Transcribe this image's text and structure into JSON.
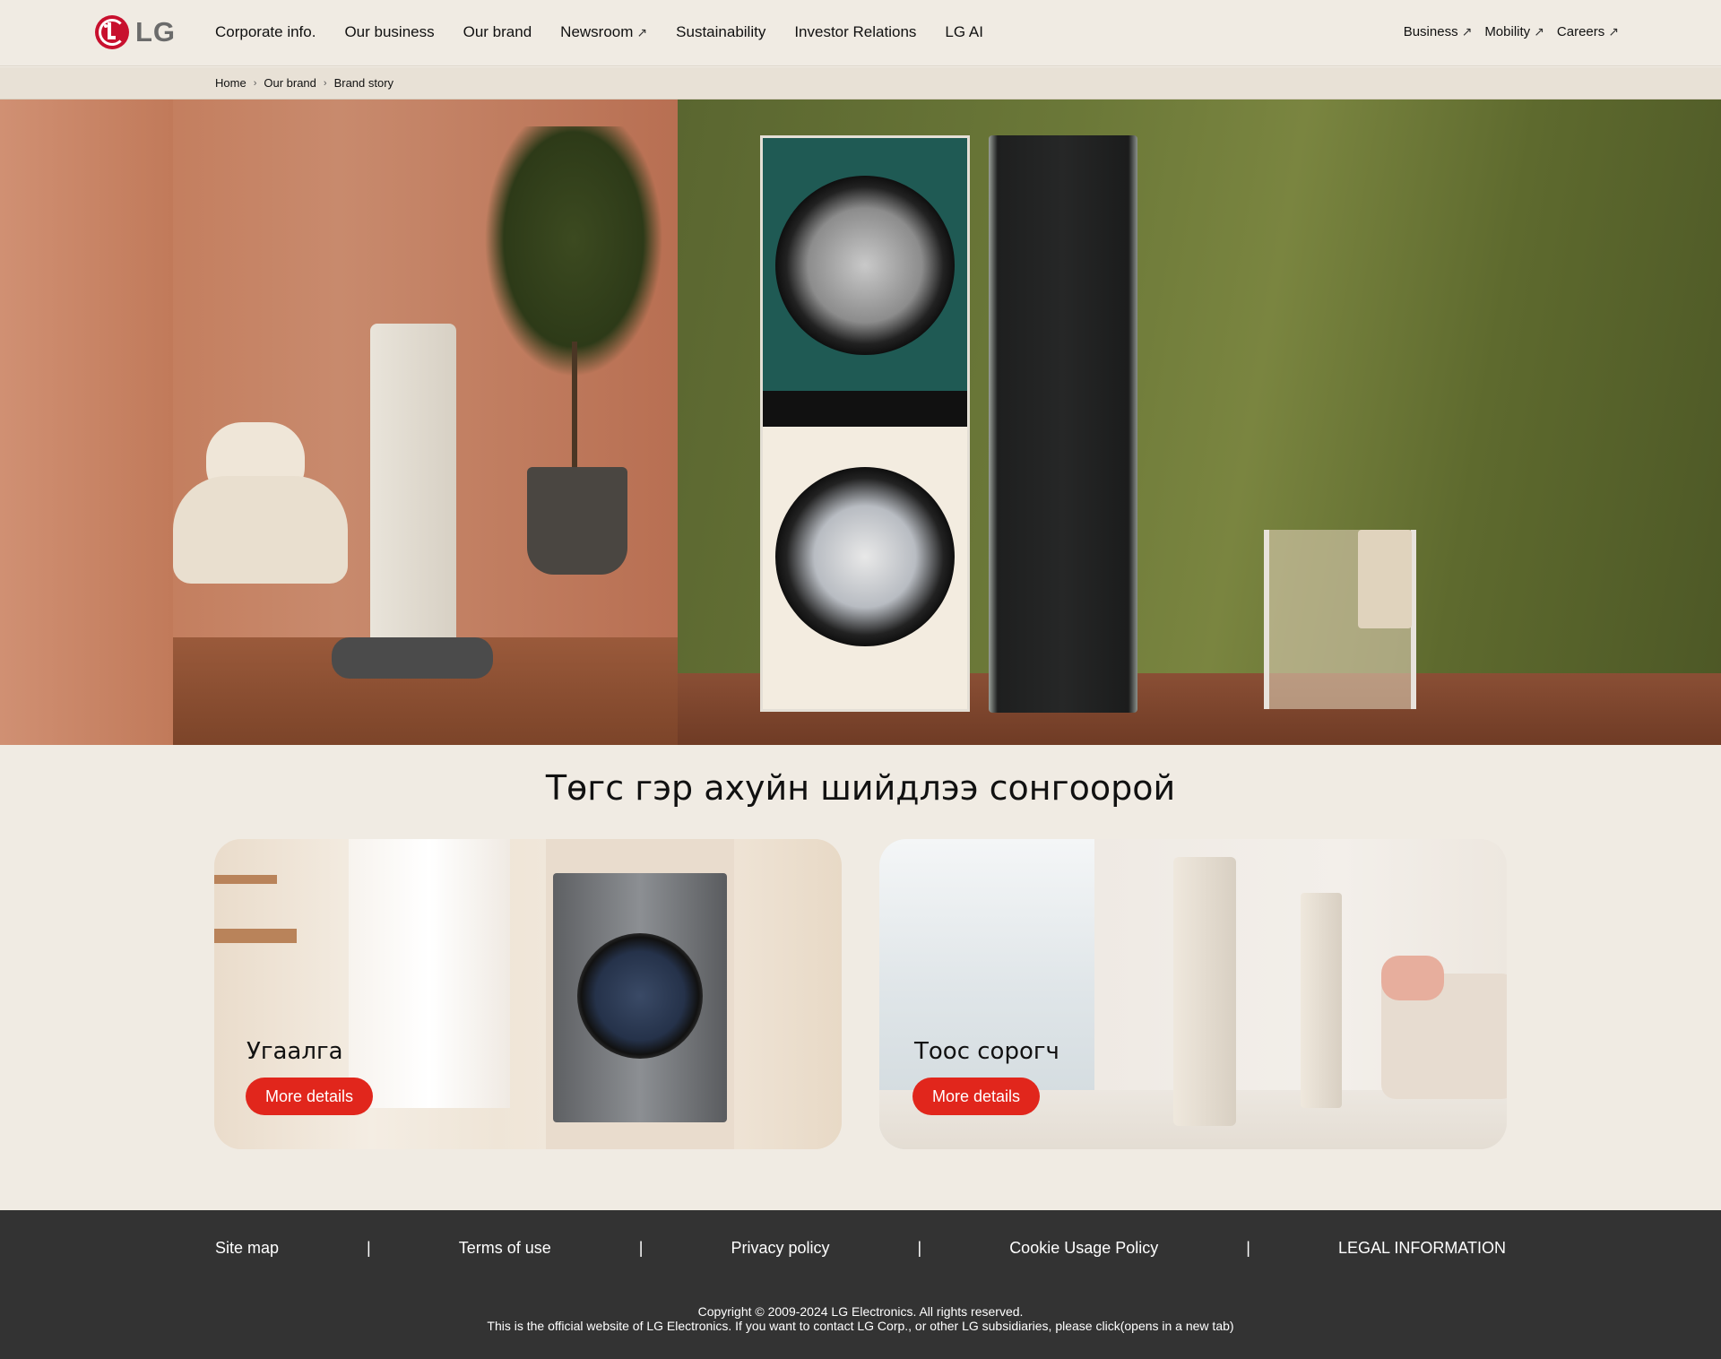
{
  "header": {
    "logo_text": "LG",
    "nav": [
      {
        "label": "Corporate info.",
        "external": false
      },
      {
        "label": "Our business",
        "external": false
      },
      {
        "label": "Our brand",
        "external": false
      },
      {
        "label": "Newsroom",
        "external": true
      },
      {
        "label": "Sustainability",
        "external": false
      },
      {
        "label": "Investor Relations",
        "external": false
      },
      {
        "label": "LG AI",
        "external": false
      }
    ],
    "right_nav": [
      {
        "label": "Business",
        "external": true
      },
      {
        "label": "Mobility",
        "external": true
      },
      {
        "label": "Careers",
        "external": true
      }
    ],
    "external_glyph": "↗"
  },
  "breadcrumb": {
    "items": [
      "Home",
      "Our brand",
      "Brand story"
    ],
    "separator": "›"
  },
  "hero": {
    "accent_left": "#c37c5c",
    "accent_right": "#6b7838"
  },
  "section": {
    "title": "Төгс гэр ахуйн шийдлээ сонгоорой"
  },
  "cards": [
    {
      "label": "Угаалга",
      "button": "More details"
    },
    {
      "label": "Тоос сорогч",
      "button": "More details"
    }
  ],
  "footer": {
    "links": [
      "Site map",
      "Terms of use",
      "Privacy policy",
      "Cookie Usage Policy",
      "LEGAL INFORMATION"
    ],
    "divider": "|",
    "copyright_line1": "Copyright © 2009-2024 LG Electronics. All rights reserved.",
    "copyright_line2": "This is the official website of LG Electronics. If you want to contact LG Corp., or other LG subsidiaries, please click(opens in a new tab)"
  },
  "colors": {
    "background": "#f0ebe3",
    "brand_red": "#c8102e",
    "button_red": "#e1261c",
    "footer": "#333333"
  }
}
